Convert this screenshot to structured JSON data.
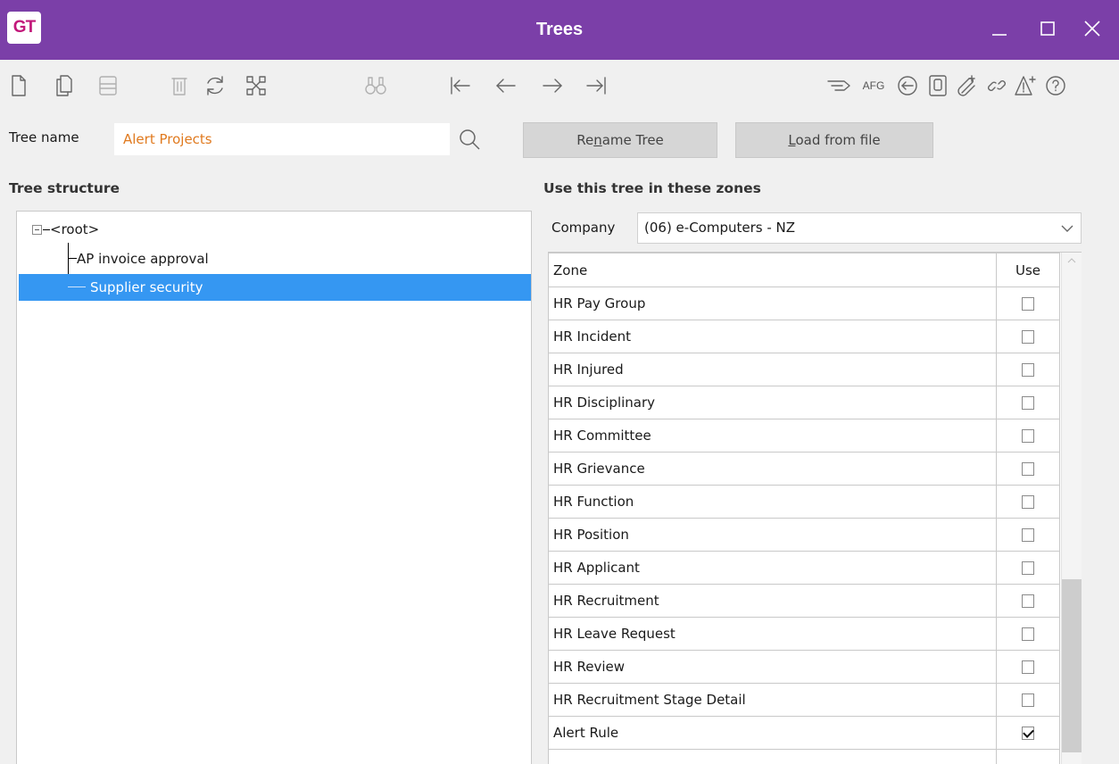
{
  "window": {
    "logo_text": "GT",
    "title": "Trees",
    "accent_color": "#7b3fa8"
  },
  "toolbar": {
    "icons": [
      "new-icon",
      "copy-icon",
      "save-icon",
      "delete-icon",
      "refresh-icon",
      "tree-structure-icon",
      "find-icon",
      "first-icon",
      "previous-icon",
      "next-icon",
      "last-icon",
      "tag-icon",
      "afg-icon",
      "back-circle-icon",
      "document-icon",
      "attach-icon",
      "link-icon",
      "alert-icon",
      "help-icon"
    ],
    "afg_label": "AFG"
  },
  "tree_name": {
    "label": "Tree name",
    "value": "Alert Projects"
  },
  "buttons": {
    "rename_pre": "Re",
    "rename_u": "n",
    "rename_post": "ame Tree",
    "load_u": "L",
    "load_post": "oad from file"
  },
  "tree_structure": {
    "heading": "Tree structure",
    "root": "<root>",
    "children": [
      "AP invoice approval",
      "Supplier security"
    ],
    "selected_index": 1
  },
  "zones": {
    "heading": "Use this tree in these zones",
    "company_label": "Company",
    "company_value": "(06) e-Computers - NZ",
    "col_zone": "Zone",
    "col_use": "Use",
    "rows": [
      {
        "zone": "HR Pay Group",
        "use": false
      },
      {
        "zone": "HR Incident",
        "use": false
      },
      {
        "zone": "HR Injured",
        "use": false
      },
      {
        "zone": "HR Disciplinary",
        "use": false
      },
      {
        "zone": "HR Committee",
        "use": false
      },
      {
        "zone": "HR Grievance",
        "use": false
      },
      {
        "zone": "HR Function",
        "use": false
      },
      {
        "zone": "HR Position",
        "use": false
      },
      {
        "zone": "HR Applicant",
        "use": false
      },
      {
        "zone": "HR Recruitment",
        "use": false
      },
      {
        "zone": "HR Leave Request",
        "use": false
      },
      {
        "zone": "HR Review",
        "use": false
      },
      {
        "zone": "HR Recruitment Stage Detail",
        "use": false
      },
      {
        "zone": "Alert Rule",
        "use": true
      }
    ]
  }
}
